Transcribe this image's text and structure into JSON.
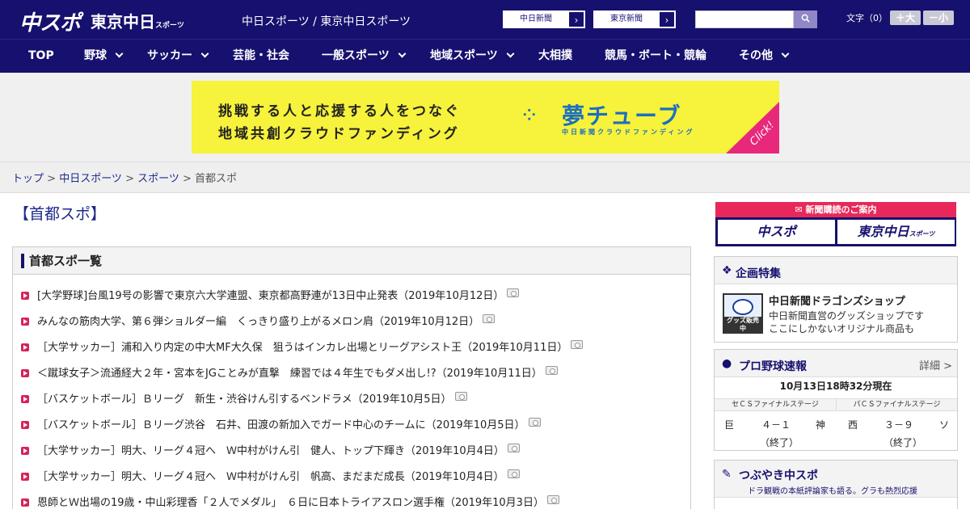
{
  "header": {
    "logo_main": "中スポ",
    "logo_tokyo": "東京中日",
    "logo_tokyo_small": "スポーツ",
    "site_title": "中日スポーツ / 東京中日スポーツ",
    "paper_links": [
      {
        "label": "中日新聞"
      },
      {
        "label": "東京新聞"
      }
    ],
    "search_placeholder": "",
    "search_icon": "search-icon",
    "font_size_label": "文字（0）",
    "font_bigger": "＋大",
    "font_smaller": "－小"
  },
  "nav": {
    "items": [
      {
        "label": "TOP"
      },
      {
        "label": "野球"
      },
      {
        "label": "サッカー"
      },
      {
        "label": "芸能・社会"
      },
      {
        "label": "一般スポーツ"
      },
      {
        "label": "地域スポーツ"
      },
      {
        "label": "大相撲"
      },
      {
        "label": "競馬・ボート・競輪"
      },
      {
        "label": "その他"
      }
    ]
  },
  "banner": {
    "line1": "挑戦する人と応援する人をつなぐ",
    "line2": "地域共創クラウドファンディング",
    "brand": "夢チューブ",
    "sub": "中日新聞クラウドファンディング",
    "click": "Click!"
  },
  "breadcrumb": {
    "items": [
      "トップ",
      "中日スポーツ",
      "スポーツ"
    ],
    "current": "首都スポ"
  },
  "page": {
    "title": "【首都スポ】",
    "list_heading": "首都スポ一覧",
    "articles": [
      {
        "text": "[大学野球]台風19号の影響で東京六大学連盟、東京都高野連が13日中止発表（2019年10月12日）"
      },
      {
        "text": "みんなの筋肉大学、第６弾ショルダー編　くっきり盛り上がるメロン肩（2019年10月12日）"
      },
      {
        "text": "［大学サッカー］浦和入り内定の中大MF大久保　狙うはインカレ出場とリーグアシスト王（2019年10月11日）"
      },
      {
        "text": "＜蹴球女子＞流通経大２年・宮本をJGことみが直撃　練習では４年生でもダメ出し!?（2019年10月11日）"
      },
      {
        "text": "［バスケットボール］Ｂリーグ　新生・渋谷けん引するベンドラメ（2019年10月5日）"
      },
      {
        "text": "［バスケットボール］Ｂリーグ渋谷　石井、田渡の新加入でガード中心のチームに（2019年10月5日）"
      },
      {
        "text": "［大学サッカー］明大、リーグ４冠へ　Ｗ中村がけん引　健人、トップ下輝き（2019年10月4日）"
      },
      {
        "text": "［大学サッカー］明大、リーグ４冠へ　Ｗ中村がけん引　帆高、まだまだ成長（2019年10月4日）"
      },
      {
        "text": "恩師とＷ出場の19歳・中山彩理香「２人でメダル」　６日に日本トライアスロン選手権（2019年10月3日）"
      }
    ]
  },
  "sidebar": {
    "subscription": {
      "heading": "新聞購読のご案内",
      "btn1": "中スポ",
      "btn2": "東京中日",
      "btn2_small": "スポーツ"
    },
    "feature": {
      "heading": "企画特集",
      "shop_title": "中日新聞ドラゴンズショップ",
      "shop_desc1": "中日新聞直営のグッズショップです",
      "shop_desc2": "ここにしかないオリジナル商品も",
      "thumb_caption": "グッズ販売中"
    },
    "baseball": {
      "heading": "プロ野球速報",
      "more": "詳細 >",
      "time": "10月13日18時32分現在",
      "games": [
        {
          "stage": "セＣＳファイナルステージ",
          "home": "巨",
          "score": "４－１",
          "away": "神",
          "status": "（終了）"
        },
        {
          "stage": "パＣＳファイナルステージ",
          "home": "西",
          "score": "３－９",
          "away": "ソ",
          "status": "（終了）"
        }
      ]
    },
    "tweet": {
      "heading": "つぶやき中スポ",
      "sub": "ドラ観戦の本紙評論家も語る。グラも熱烈応援"
    }
  },
  "colors": {
    "brand_navy": "#16106e",
    "accent_pink": "#e8285a",
    "banner_yellow": "#f7f23b",
    "banner_blue": "#1a6fbf"
  }
}
